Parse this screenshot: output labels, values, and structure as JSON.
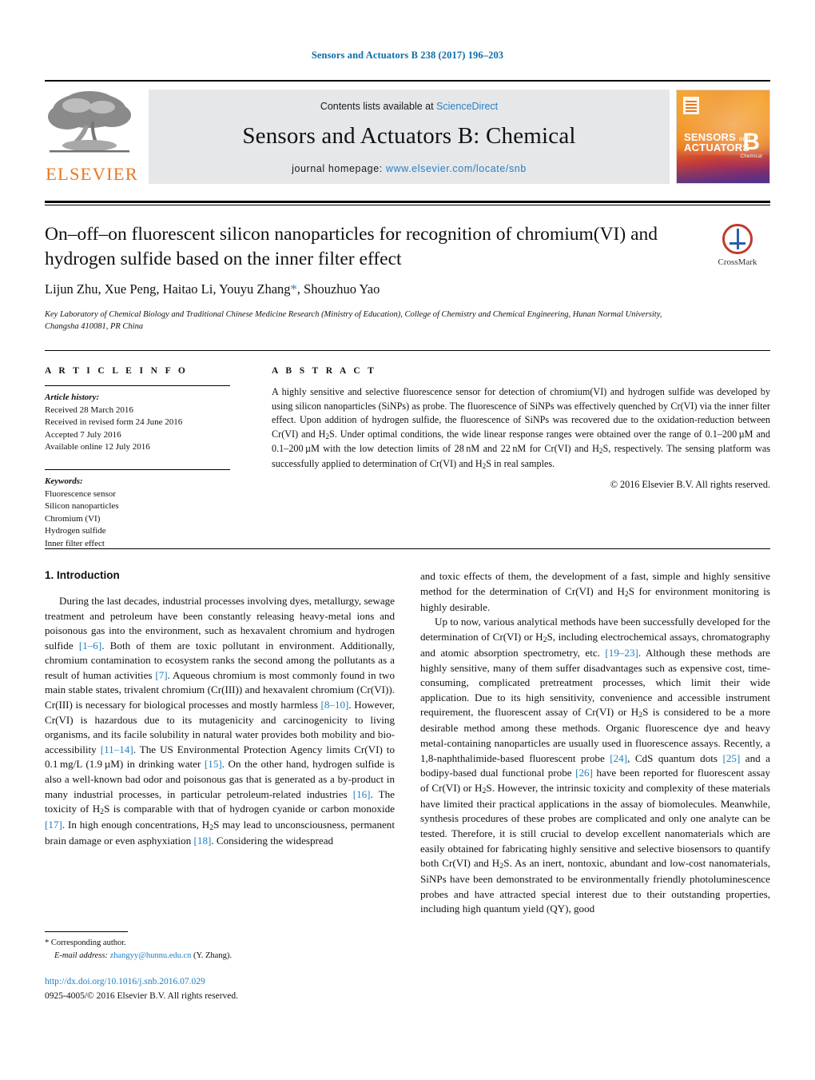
{
  "running_head": "Sensors and Actuators B 238 (2017) 196–203",
  "masthead": {
    "contents_prefix": "Contents lists available at ",
    "sciencedirect": "ScienceDirect",
    "journal_title": "Sensors and Actuators B: Chemical",
    "homepage_prefix": "journal homepage: ",
    "homepage_url": "www.elsevier.com/locate/snb",
    "publisher_logo_text": "ELSEVIER",
    "cover": {
      "line1": "SENSORS",
      "line1_small": "and",
      "line2": "ACTUATORS",
      "letter": "B",
      "letter_sub": "Chemical"
    },
    "accent_blue": "#2a7fc1",
    "elsevier_orange": "#e87722"
  },
  "article": {
    "title": "On–off–on fluorescent silicon nanoparticles for recognition of chromium(VI) and hydrogen sulfide based on the inner filter effect",
    "authors": "Lijun Zhu, Xue Peng, Haitao Li, Youyu Zhang",
    "authors_tail": ", Shouzhuo Yao",
    "corresponding_marker": "*",
    "affiliation": "Key Laboratory of Chemical Biology and Traditional Chinese Medicine Research (Ministry of Education), College of Chemistry and Chemical Engineering, Hunan Normal University, Changsha 410081, PR China",
    "crossmark_label": "CrossMark"
  },
  "article_info": {
    "heading": "A R T I C L E    I N F O",
    "history_label": "Article history:",
    "history": [
      "Received 28 March 2016",
      "Received in revised form 24 June 2016",
      "Accepted 7 July 2016",
      "Available online 12 July 2016"
    ],
    "keywords_label": "Keywords:",
    "keywords": [
      "Fluorescence sensor",
      "Silicon nanoparticles",
      "Chromium (VI)",
      "Hydrogen sulfide",
      "Inner filter effect"
    ]
  },
  "abstract": {
    "heading": "A B S T R A C T",
    "rights": "© 2016 Elsevier B.V. All rights reserved."
  },
  "body": {
    "section1_heading": "1.  Introduction"
  },
  "footnote": {
    "marker": "*",
    "corresponding": "Corresponding author.",
    "email_label": "E-mail address:",
    "email": "zhangyy@hunnu.edu.cn",
    "email_owner": "(Y. Zhang).",
    "doi": "http://dx.doi.org/10.1016/j.snb.2016.07.029",
    "issn": "0925-4005/© 2016 Elsevier B.V. All rights reserved."
  }
}
